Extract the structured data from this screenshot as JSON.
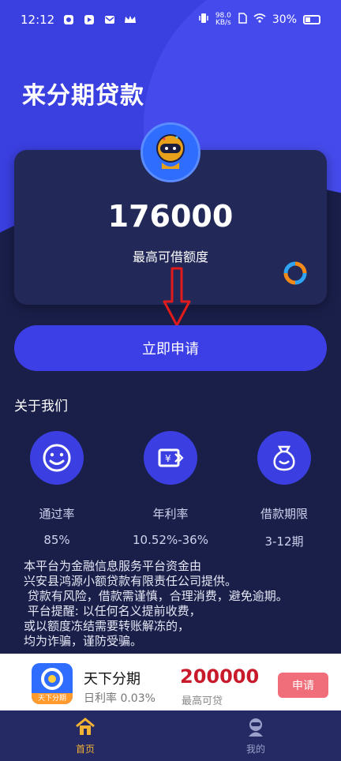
{
  "status_bar": {
    "time": "12:12",
    "speed_top": "98.0",
    "speed_bottom": "KB/s",
    "battery": "30%"
  },
  "app": {
    "title": "来分期贷款"
  },
  "card": {
    "amount": "176000",
    "amount_label": "最高可借额度"
  },
  "apply_button": {
    "label": "立即申请"
  },
  "about": {
    "title": "关于我们",
    "stats": [
      {
        "label": "通过率",
        "value": "85%",
        "icon": "smile-icon"
      },
      {
        "label": "年利率",
        "value": "10.52%-36%",
        "icon": "yuan-card-icon"
      },
      {
        "label": "借款期限",
        "value": "3-12期",
        "icon": "money-bag-icon"
      }
    ]
  },
  "description": {
    "lines": [
      "本平台为金融信息服务平台资金由",
      "兴安县鸿源小额贷款有限责任公司提供。",
      " 贷款有风险，借款需谨慎，合理消费，避免逾期。",
      " 平台提醒: 以任何名义提前收费，",
      "或以额度冻结需要转账解冻的，",
      "均为诈骗，谨防受骗。"
    ]
  },
  "ad": {
    "logo_caption": "天下分期",
    "name": "天下分期",
    "rate": "日利率 0.03%",
    "amount": "200000",
    "amount_label": "最高可贷",
    "button": "申请"
  },
  "bottom_nav": {
    "home_label": "首页",
    "mine_label": "我的"
  },
  "colors": {
    "primary": "#3d3fe6",
    "background": "#1a1f4a",
    "accent_red": "#c81a2b",
    "nav_active": "#f2b233"
  }
}
